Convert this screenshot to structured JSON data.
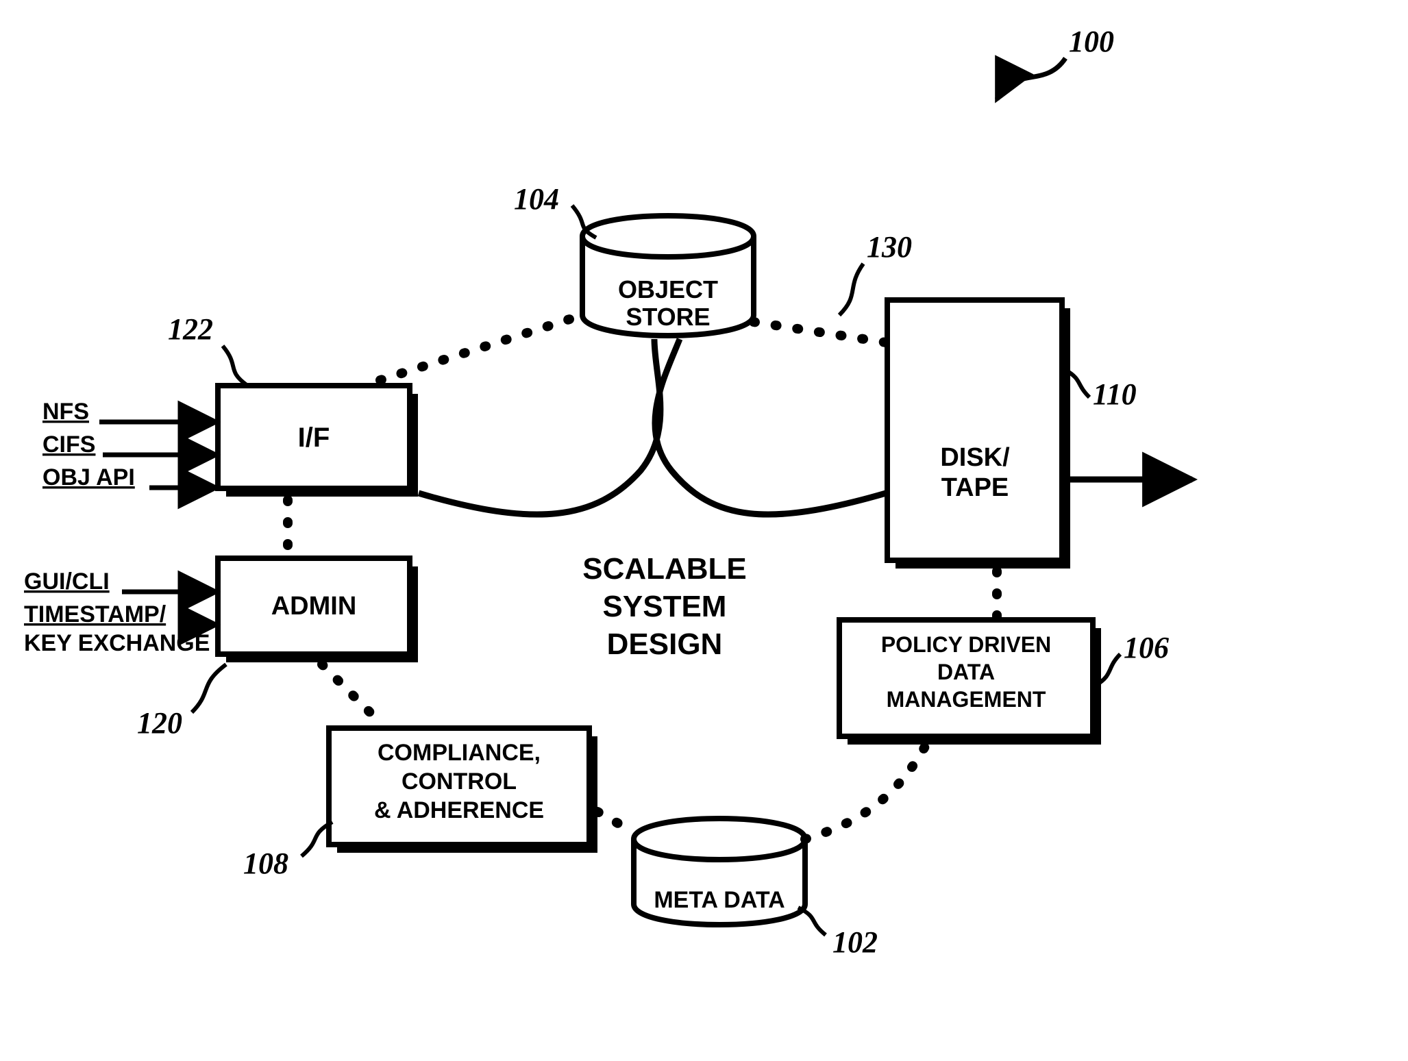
{
  "figure_ref": "100",
  "center_label": {
    "l1": "SCALABLE",
    "l2": "SYSTEM",
    "l3": "DESIGN"
  },
  "blocks": {
    "object_store": {
      "ref": "104",
      "l1": "OBJECT",
      "l2": "STORE"
    },
    "disk_tape": {
      "ref": "110",
      "l1": "DISK/",
      "l2": "TAPE"
    },
    "policy": {
      "ref": "106",
      "l1": "POLICY DRIVEN",
      "l2": "DATA",
      "l3": "MANAGEMENT"
    },
    "metadata": {
      "ref": "102",
      "l1": "META DATA"
    },
    "compliance": {
      "ref": "108",
      "l1": "COMPLIANCE,",
      "l2": "CONTROL",
      "l3": "& ADHERENCE"
    },
    "admin": {
      "ref": "120",
      "l1": "ADMIN"
    },
    "if": {
      "ref": "122",
      "l1": "I/F"
    },
    "disk_tape_link_ref": "130"
  },
  "inputs": {
    "if": {
      "a": "NFS",
      "b": "CIFS",
      "c": "OBJ API"
    },
    "admin": {
      "a": "GUI/CLI",
      "b": "TIMESTAMP/",
      "c": "KEY EXCHANGE"
    }
  }
}
